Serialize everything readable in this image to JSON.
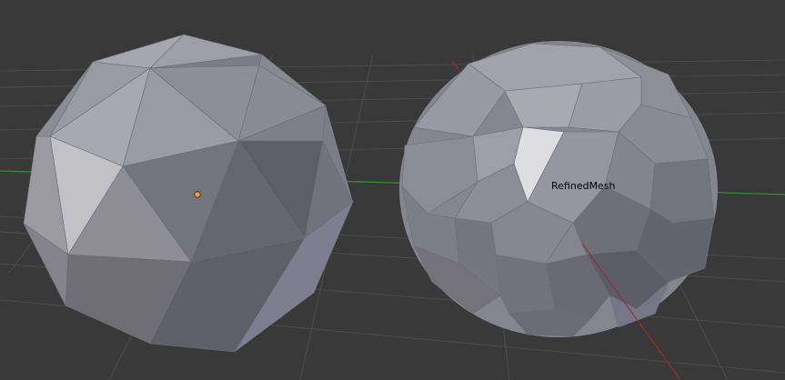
{
  "viewport": {
    "background_color": "#393939",
    "grid_color": "#4a4a4a",
    "x_axis_color": "#8c2f2f",
    "y_axis_color": "#3d8b3d"
  },
  "objects": [
    {
      "name": "",
      "kind": "icosphere",
      "base_color": "#8f8f98",
      "selected": true,
      "origin_color": "#e8a040"
    },
    {
      "name": "RefinedMesh",
      "kind": "refined-sphere",
      "base_color": "#9a9aa2",
      "selected": false
    }
  ]
}
